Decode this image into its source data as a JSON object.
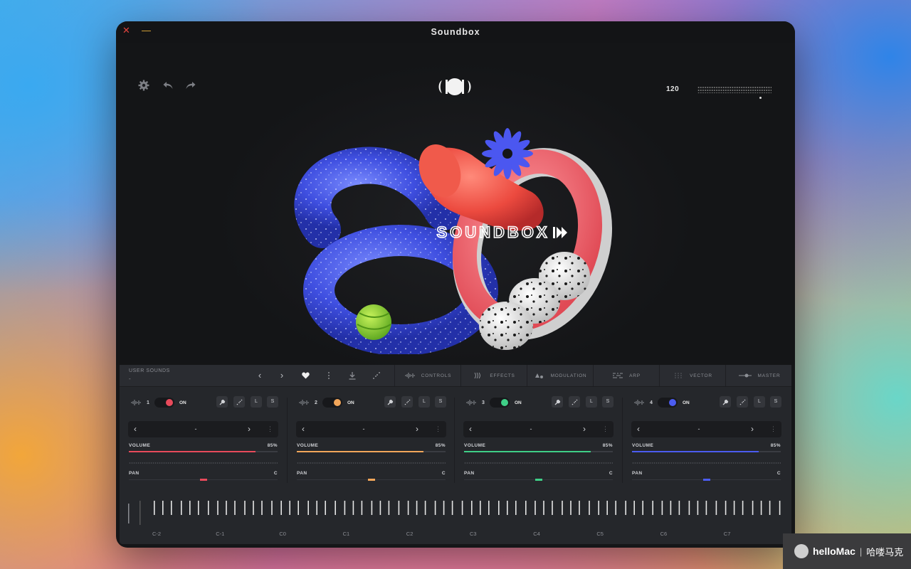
{
  "window": {
    "title": "Soundbox",
    "close": "✕",
    "minimize": "—"
  },
  "header": {
    "bpm": "120",
    "icons": [
      "gear-icon",
      "undo-icon",
      "redo-icon",
      "soundbox-logo"
    ]
  },
  "hero": {
    "artwork_text": "SOUNDBOX"
  },
  "panel": {
    "user_sounds_label": "USER SOUNDS",
    "user_sounds_value": "-",
    "nav": {
      "prev": "‹",
      "next": "›"
    },
    "tabs": [
      {
        "label": "CONTROLS",
        "icon": "waveform-icon"
      },
      {
        "label": "EFFECTS",
        "icon": "effects-icon"
      },
      {
        "label": "MODULATION",
        "icon": "modulation-icon"
      },
      {
        "label": "ARP",
        "icon": "arp-icon"
      },
      {
        "label": "VECTOR",
        "icon": "vector-icon"
      },
      {
        "label": "MASTER",
        "icon": "master-icon"
      }
    ]
  },
  "channels": [
    {
      "number": "1",
      "on_label": "ON",
      "color": "#e84a5b",
      "preset": "-",
      "volume_label": "VOLUME",
      "volume": "85%",
      "volume_value": 0.85,
      "pan_label": "PAN",
      "pan": "C",
      "btn_l": "L",
      "btn_s": "S",
      "prev": "‹",
      "next": "›",
      "more": "⋮"
    },
    {
      "number": "2",
      "on_label": "ON",
      "color": "#f2a65a",
      "preset": "-",
      "volume_label": "VOLUME",
      "volume": "85%",
      "volume_value": 0.85,
      "pan_label": "PAN",
      "pan": "C",
      "btn_l": "L",
      "btn_s": "S",
      "prev": "‹",
      "next": "›",
      "more": "⋮"
    },
    {
      "number": "3",
      "on_label": "ON",
      "color": "#3fcf87",
      "preset": "-",
      "volume_label": "VOLUME",
      "volume": "85%",
      "volume_value": 0.85,
      "pan_label": "PAN",
      "pan": "C",
      "btn_l": "L",
      "btn_s": "S",
      "prev": "‹",
      "next": "›",
      "more": "⋮"
    },
    {
      "number": "4",
      "on_label": "ON",
      "color": "#4b5cf0",
      "preset": "-",
      "volume_label": "VOLUME",
      "volume": "85%",
      "volume_value": 0.85,
      "pan_label": "PAN",
      "pan": "C",
      "btn_l": "L",
      "btn_s": "S",
      "prev": "‹",
      "next": "›",
      "more": "⋮"
    }
  ],
  "keyboard": {
    "octaves": [
      "C-2",
      "C-1",
      "C0",
      "C1",
      "C2",
      "C3",
      "C4",
      "C5",
      "C6",
      "C7"
    ]
  },
  "watermark": {
    "brand": "helloMac",
    "sep": "|",
    "cn": "哈喽马克"
  }
}
